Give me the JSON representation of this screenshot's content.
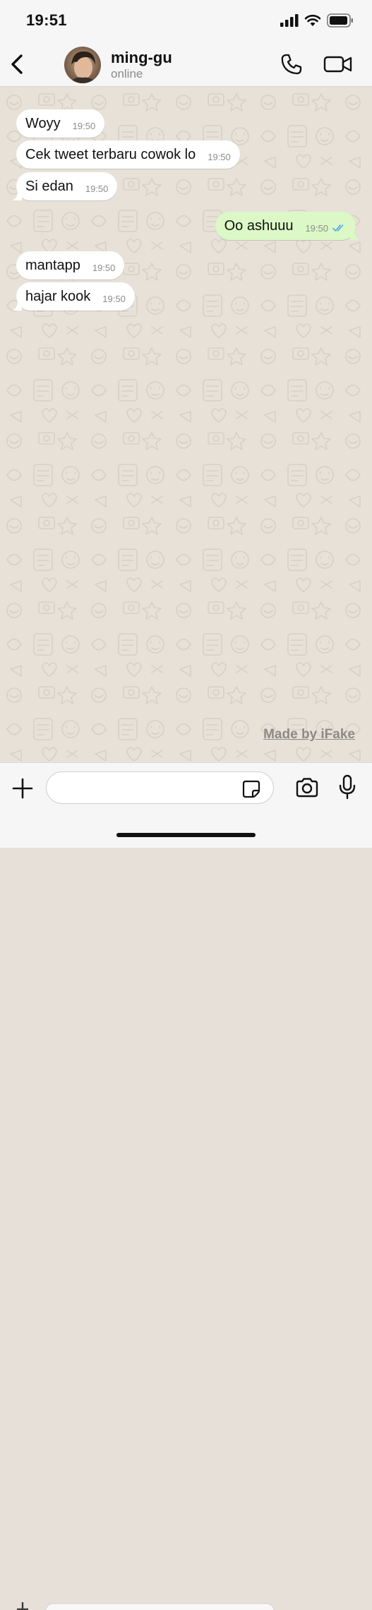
{
  "status_bar": {
    "time": "19:51"
  },
  "header": {
    "name": "ming-gu",
    "status": "online"
  },
  "messages": [
    {
      "direction": "in",
      "text": "Woyy",
      "time": "19:50"
    },
    {
      "direction": "in",
      "text": "Cek tweet terbaru cowok lo",
      "time": "19:50"
    },
    {
      "direction": "in",
      "text": "Si edan",
      "time": "19:50"
    },
    {
      "direction": "out",
      "text": "Oo ashuuu",
      "time": "19:50",
      "read": true
    },
    {
      "direction": "in",
      "text": "mantapp",
      "time": "19:50"
    },
    {
      "direction": "in",
      "text": "hajar kook",
      "time": "19:50"
    }
  ],
  "watermark": "Made by iFake",
  "input": {
    "placeholder": "",
    "value": ""
  },
  "colors": {
    "incoming": "#ffffff",
    "outgoing": "#dbf8c6",
    "read_ticks": "#4fa6e8",
    "wallpaper": "#e7e1d8"
  },
  "icons": [
    "back-chevron",
    "phone",
    "video-camera",
    "plus",
    "sticker",
    "camera",
    "microphone",
    "signal",
    "wifi",
    "battery"
  ]
}
